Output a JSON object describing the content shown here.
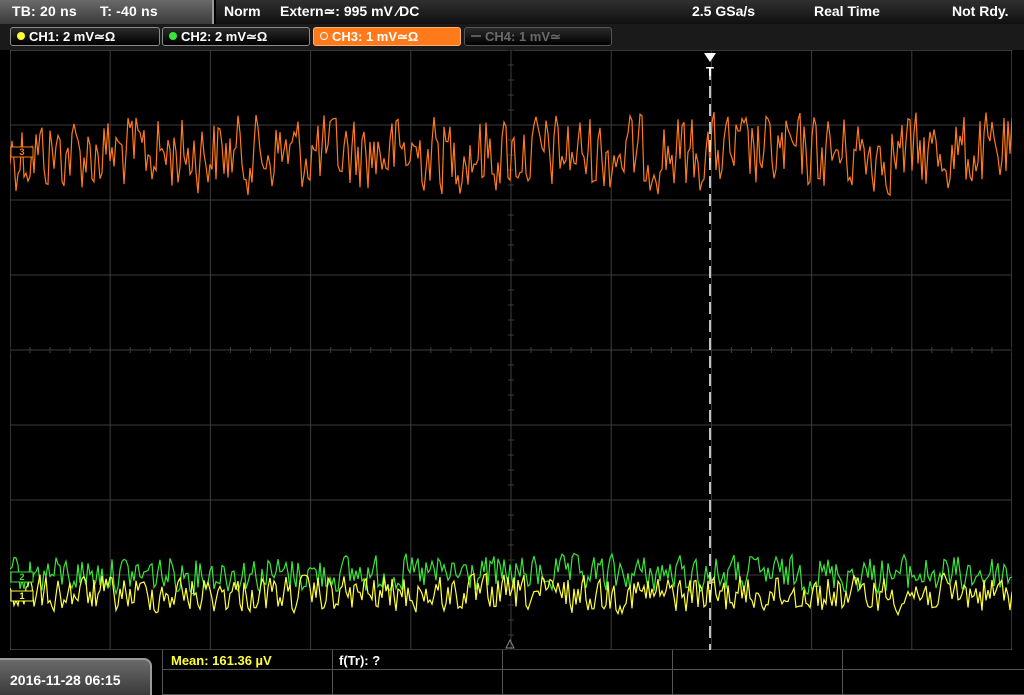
{
  "topbar": {
    "timebase": "TB: 20 ns",
    "trigger_pos": "T: -40 ns",
    "trigger_mode": "Norm",
    "trigger_source": "Extern≃: 995 mV ∕DC",
    "sample_rate": "2.5 GSa/s",
    "acq_mode": "Real Time",
    "status": "Not Rdy."
  },
  "channels": [
    {
      "label": "CH1: 2 mV≃Ω",
      "color": "#ffff3a",
      "active": true
    },
    {
      "label": "CH2: 2 mV≃Ω",
      "color": "#39e639",
      "active": true
    },
    {
      "label": "CH3: 1 mV≃Ω",
      "color": "#ff7a1a",
      "active": true,
      "selected": true
    },
    {
      "label": "CH4: 1 mV≃",
      "color": "#5a5a5a",
      "active": false
    }
  ],
  "markers": {
    "trigger": "T",
    "ch3": "3",
    "ch2": "2",
    "ch1": "1"
  },
  "footer": {
    "datetime": "2016-11-28 06:15",
    "mean": "Mean: 161.36 µV",
    "freq": "f(Tr): ?"
  },
  "colors": {
    "ch1": "#ffff3a",
    "ch2": "#39e639",
    "ch3": "#ff7a1a",
    "grid": "#3c3c3c",
    "trigger": "#ffffff"
  }
}
